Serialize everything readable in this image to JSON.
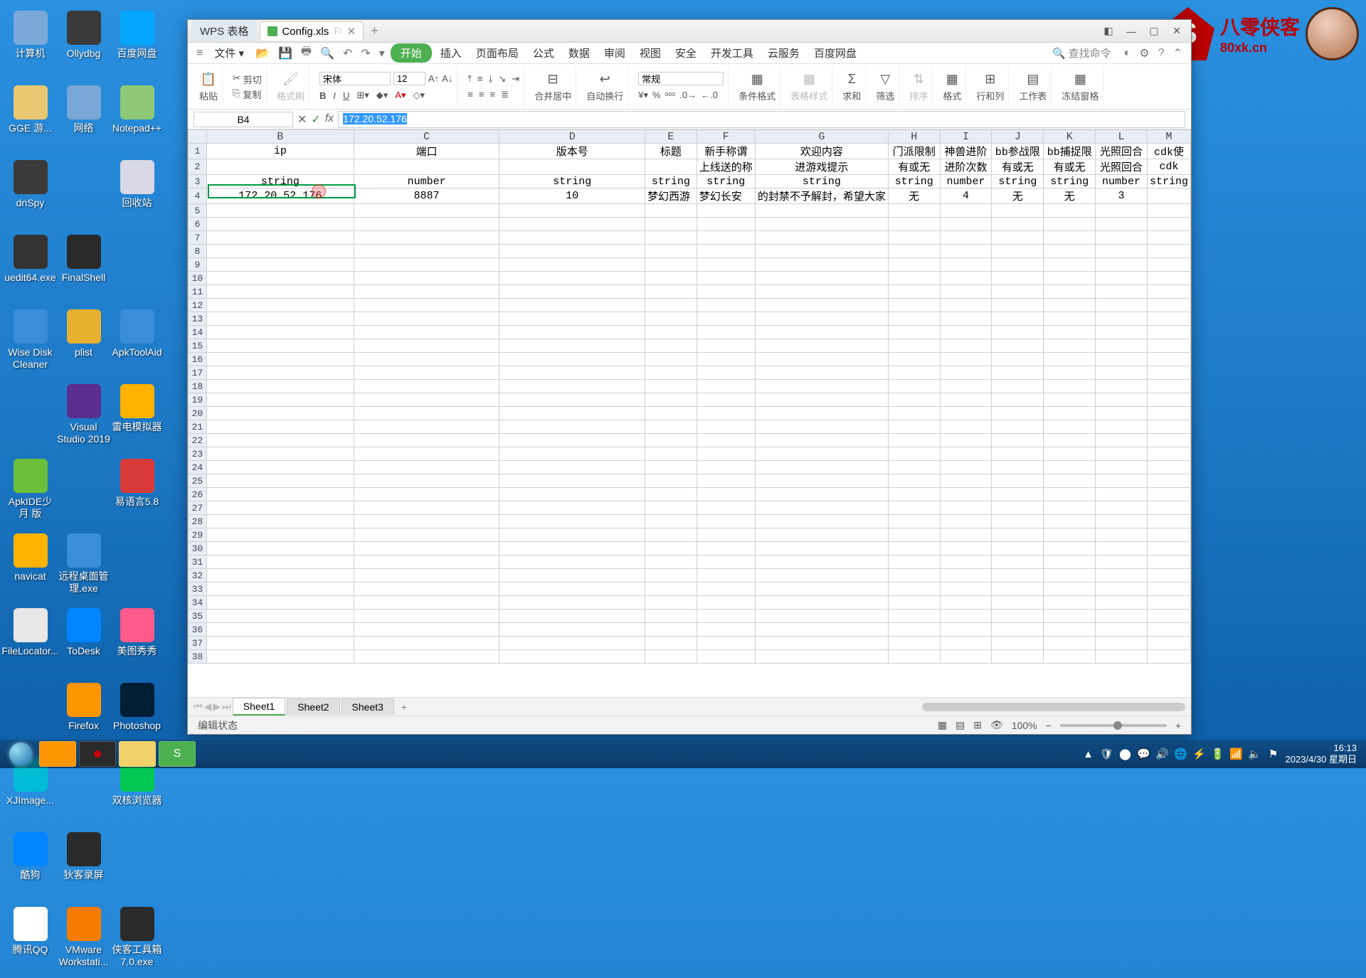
{
  "desktop_icons": [
    {
      "label": "计算机",
      "color": "#7aa8d8"
    },
    {
      "label": "Ollydbg",
      "color": "#3a3a3a"
    },
    {
      "label": "百度网盘",
      "color": "#06a7ff"
    },
    {
      "label": "GGE\n游...",
      "color": "#e8c870"
    },
    {
      "label": "网络",
      "color": "#7aa8d8"
    },
    {
      "label": "Notepad++",
      "color": "#8fc977"
    },
    {
      "label": "dnSpy",
      "color": "#3a3a3a"
    },
    {
      "label": "",
      "color": "transparent"
    },
    {
      "label": "回收站",
      "color": "#d8d8e8"
    },
    {
      "label": "uedit64.exe",
      "color": "#333"
    },
    {
      "label": "FinalShell",
      "color": "#2a2a2a"
    },
    {
      "label": "",
      "color": "transparent"
    },
    {
      "label": "Wise Disk\nCleaner",
      "color": "#3a8dd8"
    },
    {
      "label": "plist",
      "color": "#e8b030"
    },
    {
      "label": "ApkToolAid",
      "color": "#3a8dd8"
    },
    {
      "label": "",
      "color": "transparent"
    },
    {
      "label": "Visual\nStudio 2019",
      "color": "#5c2d91"
    },
    {
      "label": "雷电模拟器",
      "color": "#ffb300"
    },
    {
      "label": "ApkIDE少月\n版",
      "color": "#6bbf3a"
    },
    {
      "label": "",
      "color": "transparent"
    },
    {
      "label": "易语言5.8",
      "color": "#d83a3a"
    },
    {
      "label": "navicat",
      "color": "#ffb300"
    },
    {
      "label": "远程桌面管\n理.exe",
      "color": "#3a8dd8"
    },
    {
      "label": "",
      "color": "transparent"
    },
    {
      "label": "FileLocator...",
      "color": "#e8e8e8"
    },
    {
      "label": "ToDesk",
      "color": "#0084ff"
    },
    {
      "label": "美图秀秀",
      "color": "#ff5a8c"
    },
    {
      "label": "",
      "color": "transparent"
    },
    {
      "label": "Firefox",
      "color": "#ff9500"
    },
    {
      "label": "Photoshop",
      "color": "#001e36"
    },
    {
      "label": "XJImage...",
      "color": "#00bcd4"
    },
    {
      "label": "",
      "color": "transparent"
    },
    {
      "label": "双核浏览器",
      "color": "#00c853"
    },
    {
      "label": "酷狗",
      "color": "#0084ff"
    },
    {
      "label": "狄客录屏",
      "color": "#2a2a2a"
    },
    {
      "label": "",
      "color": "transparent"
    },
    {
      "label": "腾讯QQ",
      "color": "#fff"
    },
    {
      "label": "VMware\nWorkstati...",
      "color": "#f57c00"
    },
    {
      "label": "侠客工具箱\n7.0.exe",
      "color": "#2a2a2a"
    }
  ],
  "window": {
    "app_tab": "WPS 表格",
    "file_tab": "Config.xls",
    "menu_file": "文件",
    "menu": {
      "start": "开始",
      "insert": "插入",
      "layout": "页面布局",
      "formula": "公式",
      "data": "数据",
      "review": "审阅",
      "view": "视图",
      "security": "安全",
      "dev": "开发工具",
      "cloud": "云服务",
      "baidu": "百度网盘"
    },
    "search_placeholder": "查找命令",
    "ribbon": {
      "paste": "粘贴",
      "cut": "剪切",
      "copy": "复制",
      "fmtpaint": "格式刷",
      "font": "宋体",
      "size": "12",
      "merge": "合并居中",
      "wrap": "自动换行",
      "normal": "常规",
      "condfmt": "条件格式",
      "tablefmt": "表格样式",
      "sum": "求和",
      "filter": "筛选",
      "sort": "排序",
      "format": "格式",
      "rowcol": "行和列",
      "sheet": "工作表",
      "freeze": "冻结窗格"
    }
  },
  "namebox": "B4",
  "formula": "172.20.52.176",
  "columns": [
    "B",
    "C",
    "D",
    "E",
    "F",
    "G",
    "H",
    "I",
    "J",
    "K",
    "L",
    "M"
  ],
  "headers_row1": [
    "ip",
    "端口",
    "版本号",
    "标题",
    "新手称谓",
    "欢迎内容",
    "门派限制",
    "神兽进阶",
    "bb参战限",
    "bb捕捉限",
    "光照回合",
    "cdk使"
  ],
  "headers_row2": [
    "",
    "",
    "",
    "",
    "上线送的称",
    "进游戏提示",
    "有或无",
    "进阶次数",
    "有或无",
    "有或无",
    "光照回合",
    "cdk"
  ],
  "types_row": [
    "string",
    "number",
    "string",
    "string",
    "string",
    "string",
    "string",
    "number",
    "string",
    "string",
    "number",
    "string"
  ],
  "data_row": [
    "172.20.52.176",
    "8887",
    "10",
    "梦幻西游",
    "梦幻长安",
    "的封禁不予解封，希望大家",
    "无",
    "4",
    "无",
    "无",
    "3",
    ""
  ],
  "sheets": [
    "Sheet1",
    "Sheet2",
    "Sheet3"
  ],
  "status": "编辑状态",
  "zoom": "100%",
  "taskbar": {
    "time": "16:13",
    "date": "2023/4/30 星期日"
  },
  "watermark": {
    "title": "八零侠客",
    "url": "80xk.cn"
  }
}
